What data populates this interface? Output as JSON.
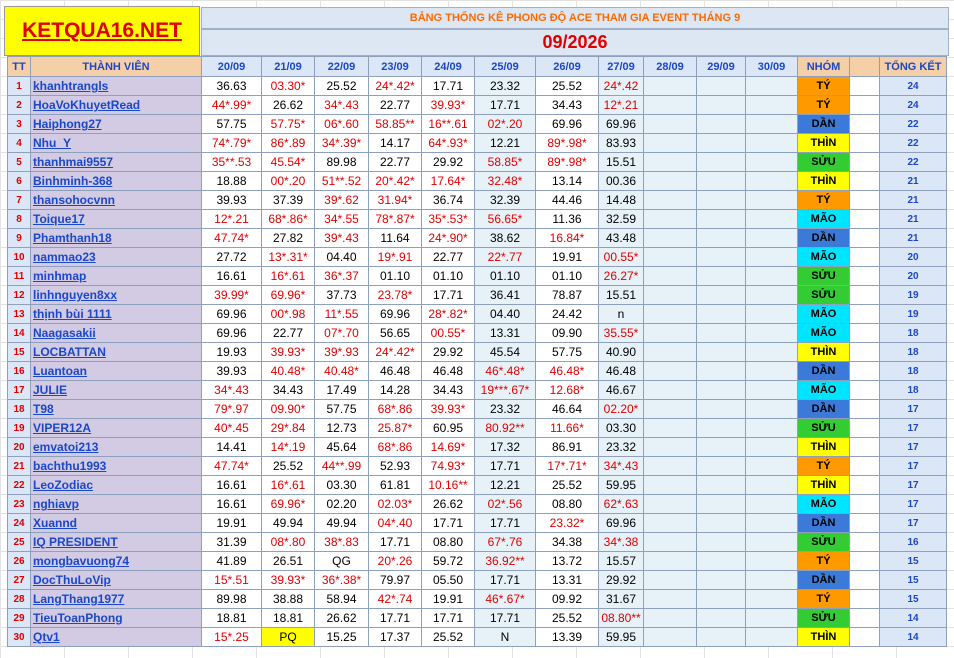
{
  "logo": "KETQUA16.NET",
  "title": "BẢNG THỐNG KÊ PHONG ĐỘ ACE THAM GIA EVENT THÁNG 9",
  "month": "09/2026",
  "headers": {
    "tt": "TT",
    "member": "THÀNH VIÊN",
    "dates": [
      "20/09",
      "21/09",
      "22/09",
      "23/09",
      "24/09",
      "25/09",
      "26/09",
      "27/09",
      "28/09",
      "29/09",
      "30/09"
    ],
    "group": "NHÓM",
    "total": "TỔNG KẾT"
  },
  "group_colors": {
    "TÝ": "#ff9900",
    "DẦN": "#3c7ad9",
    "THÌN": "#ffff00",
    "SỬU": "#33cc33",
    "MÃO": "#00e5ff"
  },
  "rows": [
    {
      "tt": "1",
      "name": "khanhtrangls",
      "v": [
        "36.63",
        "03.30*",
        "25.52",
        "24*.42*",
        "17.71",
        "23.32",
        "25.52",
        "24*.42"
      ],
      "group": "TÝ",
      "total": "24"
    },
    {
      "tt": "2",
      "name": "HoaVoKhuyetRead",
      "v": [
        "44*.99*",
        "26.62",
        "34*.43",
        "22.77",
        "39.93*",
        "17.71",
        "34.43",
        "12*.21"
      ],
      "group": "TÝ",
      "total": "24"
    },
    {
      "tt": "3",
      "name": "Haiphong27",
      "v": [
        "57.75",
        "57.75*",
        "06*.60",
        "58.85**",
        "16**.61",
        "02*.20",
        "69.96",
        "69.96"
      ],
      "group": "DẦN",
      "total": "22"
    },
    {
      "tt": "4",
      "name": "Nhu_Y",
      "v": [
        "74*.79*",
        "86*.89",
        "34*.39*",
        "14.17",
        "64*.93*",
        "12.21",
        "89*.98*",
        "83.93"
      ],
      "group": "THÌN",
      "total": "22"
    },
    {
      "tt": "5",
      "name": "thanhmai9557",
      "v": [
        "35**.53",
        "45.54*",
        "89.98",
        "22.77",
        "29.92",
        "58.85*",
        "89*.98*",
        "15.51"
      ],
      "group": "SỬU",
      "total": "22"
    },
    {
      "tt": "6",
      "name": "Binhminh-368",
      "v": [
        "18.88",
        "00*.20",
        "51**.52",
        "20*.42*",
        "17.64*",
        "32.48*",
        "13.14",
        "00.36"
      ],
      "group": "THÌN",
      "total": "21"
    },
    {
      "tt": "7",
      "name": "thansohocvnn",
      "v": [
        "39.93",
        "37.39",
        "39*.62",
        "31.94*",
        "36.74",
        "32.39",
        "44.46",
        "14.48"
      ],
      "group": "TÝ",
      "total": "21"
    },
    {
      "tt": "8",
      "name": "Toique17",
      "v": [
        "12*.21",
        "68*.86*",
        "34*.55",
        "78*.87*",
        "35*.53*",
        "56.65*",
        "11.36",
        "32.59"
      ],
      "group": "MÃO",
      "total": "21"
    },
    {
      "tt": "9",
      "name": "Phamthanh18",
      "v": [
        "47.74*",
        "27.82",
        "39*.43",
        "11.64",
        "24*.90*",
        "38.62",
        "16.84*",
        "43.48"
      ],
      "group": "DẦN",
      "total": "21"
    },
    {
      "tt": "10",
      "name": "nammao23",
      "v": [
        "27.72",
        "13*.31*",
        "04.40",
        "19*.91",
        "22.77",
        "22*.77",
        "19.91",
        "00.55*"
      ],
      "group": "MÃO",
      "total": "20"
    },
    {
      "tt": "11",
      "name": "minhmap",
      "v": [
        "16.61",
        "16*.61",
        "36*.37",
        "01.10",
        "01.10",
        "01.10",
        "01.10",
        "26.27*"
      ],
      "group": "SỬU",
      "total": "20"
    },
    {
      "tt": "12",
      "name": "linhnguyen8xx",
      "v": [
        "39.99*",
        "69.96*",
        "37.73",
        "23.78*",
        "17.71",
        "36.41",
        "78.87",
        "15.51"
      ],
      "group": "SỬU",
      "total": "19"
    },
    {
      "tt": "13",
      "name": "thịnh bùi 1111",
      "v": [
        "69.96",
        "00*.98",
        "11*.55",
        "69.96",
        "28*.82*",
        "04.40",
        "24.42",
        "n"
      ],
      "group": "MÃO",
      "total": "19"
    },
    {
      "tt": "14",
      "name": "Naagasakii",
      "v": [
        "69.96",
        "22.77",
        "07*.70",
        "56.65",
        "00.55*",
        "13.31",
        "09.90",
        "35.55*"
      ],
      "group": "MÃO",
      "total": "18"
    },
    {
      "tt": "15",
      "name": "LOCBATTAN",
      "v": [
        "19.93",
        "39.93*",
        "39*.93",
        "24*.42*",
        "29.92",
        "45.54",
        "57.75",
        "40.90"
      ],
      "group": "THÌN",
      "total": "18"
    },
    {
      "tt": "16",
      "name": "Luantoan",
      "v": [
        "39.93",
        "40.48*",
        "40.48*",
        "46.48",
        "46.48",
        "46*.48*",
        "46.48*",
        "46.48"
      ],
      "group": "DẦN",
      "total": "18"
    },
    {
      "tt": "17",
      "name": "JULIE",
      "v": [
        "34*.43",
        "34.43",
        "17.49",
        "14.28",
        "34.43",
        "19***.67*",
        "12.68*",
        "46.67"
      ],
      "group": "MÃO",
      "total": "18"
    },
    {
      "tt": "18",
      "name": "T98",
      "v": [
        "79*.97",
        "09.90*",
        "57.75",
        "68*.86",
        "39.93*",
        "23.32",
        "46.64",
        "02.20*"
      ],
      "group": "DẦN",
      "total": "17"
    },
    {
      "tt": "19",
      "name": "VIPER12A",
      "v": [
        "40*.45",
        "29*.84",
        "12.73",
        "25.87*",
        "60.95",
        "80.92**",
        "11.66*",
        "03.30"
      ],
      "group": "SỬU",
      "total": "17"
    },
    {
      "tt": "20",
      "name": "emvatoi213",
      "v": [
        "14.41",
        "14*.19",
        "45.64",
        "68*.86",
        "14.69*",
        "17.32",
        "86.91",
        "23.32"
      ],
      "group": "THÌN",
      "total": "17"
    },
    {
      "tt": "21",
      "name": "bachthu1993",
      "v": [
        "47.74*",
        "25.52",
        "44**.99",
        "52.93",
        "74.93*",
        "17.71",
        "17*.71*",
        "34*.43"
      ],
      "group": "TÝ",
      "total": "17"
    },
    {
      "tt": "22",
      "name": "LeoZodiac",
      "v": [
        "16.61",
        "16*.61",
        "03.30",
        "61.81",
        "10.16**",
        "12.21",
        "25.52",
        "59.95"
      ],
      "group": "THÌN",
      "total": "17"
    },
    {
      "tt": "23",
      "name": "nghiavp",
      "v": [
        "16.61",
        "69.96*",
        "02.20",
        "02.03*",
        "26.62",
        "02*.56",
        "08.80",
        "62*.63"
      ],
      "group": "MÃO",
      "total": "17"
    },
    {
      "tt": "24",
      "name": "Xuannd",
      "v": [
        "19.91",
        "49.94",
        "49.94",
        "04*.40",
        "17.71",
        "17.71",
        "23.32*",
        "69.96"
      ],
      "group": "DẦN",
      "total": "17"
    },
    {
      "tt": "25",
      "name": "IQ PRESIDENT",
      "v": [
        "31.39",
        "08*.80",
        "38*.83",
        "17.71",
        "08.80",
        "67*.76",
        "34.38",
        "34*.38"
      ],
      "group": "SỬU",
      "total": "16"
    },
    {
      "tt": "26",
      "name": "mongbavuong74",
      "v": [
        "41.89",
        "26.51",
        "QG",
        "20*.26",
        "59.72",
        "36.92**",
        "13.72",
        "15.57"
      ],
      "group": "TÝ",
      "total": "15"
    },
    {
      "tt": "27",
      "name": "DocThuLoVip",
      "v": [
        "15*.51",
        "39.93*",
        "36*.38*",
        "79.97",
        "05.50",
        "17.71",
        "13.31",
        "29.92"
      ],
      "group": "DẦN",
      "total": "15"
    },
    {
      "tt": "28",
      "name": "LangThang1977",
      "v": [
        "89.98",
        "38.88",
        "58.94",
        "42*.74",
        "19.91",
        "46*.67*",
        "09.92",
        "31.67"
      ],
      "group": "TÝ",
      "total": "15"
    },
    {
      "tt": "29",
      "name": "TieuToanPhong",
      "v": [
        "18.81",
        "18.81",
        "26.62",
        "17.71",
        "17.71",
        "17.71",
        "25.52",
        "08.80**"
      ],
      "group": "SỬU",
      "total": "14"
    },
    {
      "tt": "30",
      "name": "Qtv1",
      "v": [
        "15*.25",
        "PQ",
        "15.25",
        "17.37",
        "25.52",
        "N",
        "13.39",
        "59.95"
      ],
      "group": "THÌN",
      "total": "14"
    }
  ]
}
